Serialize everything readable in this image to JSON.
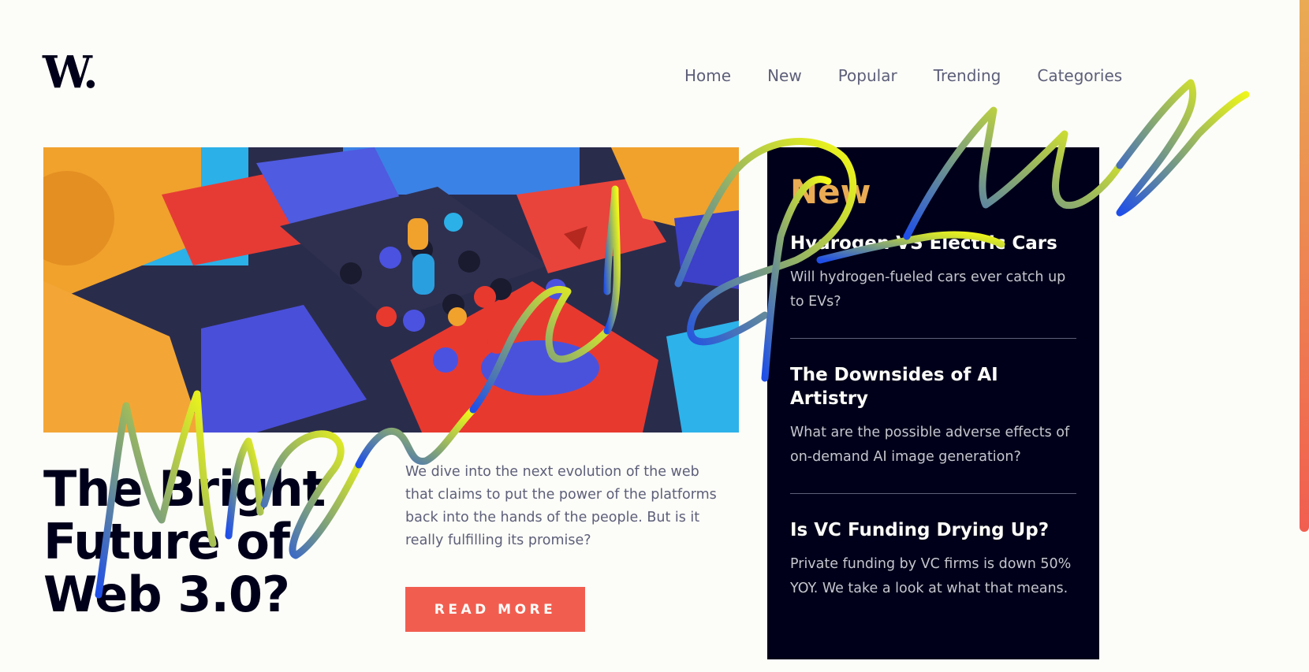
{
  "header": {
    "logo": "W.",
    "nav": [
      "Home",
      "New",
      "Popular",
      "Trending",
      "Categories"
    ]
  },
  "hero": {
    "title": "The Bright Future of Web 3.0?",
    "description": "We dive into the next evolution of the web that claims to put the power of the platforms back into the hands of the people. But is it really fulfilling its promise?",
    "button": "READ MORE"
  },
  "new_panel": {
    "heading": "New",
    "items": [
      {
        "title": "Hydrogen VS Electric Cars",
        "description": "Will hydrogen-fueled cars ever catch up to EVs?"
      },
      {
        "title": "The Downsides of AI Artistry",
        "description": "What are the possible adverse effects of on-demand AI image generation?"
      },
      {
        "title": "Is VC Funding Drying Up?",
        "description": "Private funding by VC firms is down 50% YOY. We take a look at what that means."
      }
    ]
  },
  "signature": {
    "text": "Miguel Ramos"
  },
  "colors": {
    "background": "#fcfcf8",
    "dark": "#00001a",
    "accent_red": "#f15e50",
    "accent_orange": "#e9ab53",
    "muted": "#5d5f79"
  }
}
